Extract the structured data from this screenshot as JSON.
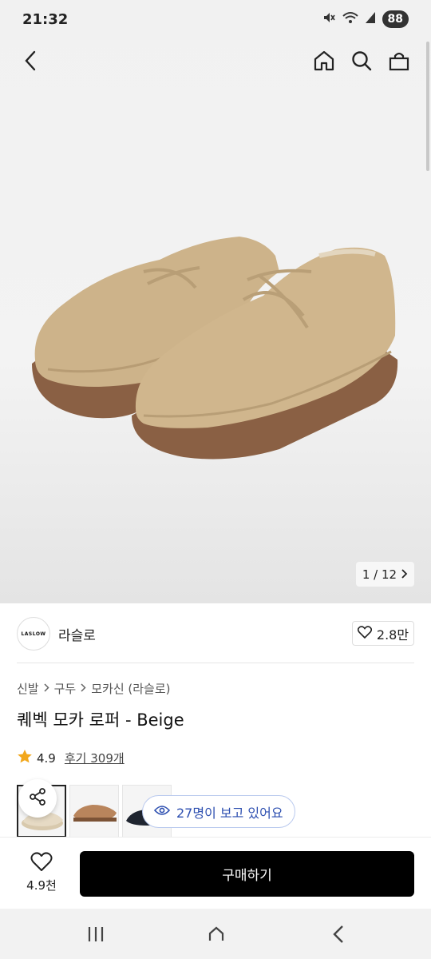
{
  "status_bar": {
    "time": "21:32",
    "battery": "88"
  },
  "icons": {
    "back": "back-arrow-icon",
    "home": "home-icon",
    "search": "search-icon",
    "cart": "shopping-bag-icon"
  },
  "gallery": {
    "counter": "1 / 12"
  },
  "seller": {
    "logo_text": "LASLOW",
    "name": "라슬로",
    "likes": "2.8만"
  },
  "breadcrumb": [
    "신발",
    "구두",
    "모카신 (라슬로)"
  ],
  "product": {
    "title": "퀘벡 모카 로퍼 - Beige",
    "rating": "4.9",
    "review_link": "후기 309개"
  },
  "viewers": {
    "text": "27명이 보고 있어요"
  },
  "bottom_bar": {
    "wish_count": "4.9천",
    "buy_label": "구매하기"
  },
  "colors": {
    "star": "#f2a71b",
    "viewer_blue": "#2d4fb0",
    "buy_bg": "#000000"
  }
}
